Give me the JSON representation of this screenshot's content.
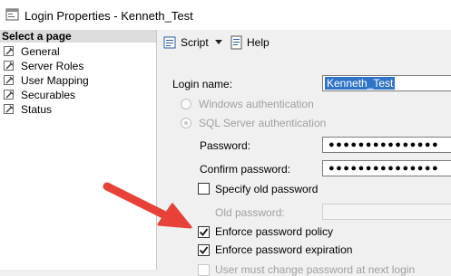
{
  "window": {
    "title": "Login Properties - Kenneth_Test"
  },
  "left_pane": {
    "header": "Select a page",
    "pages": [
      {
        "label": "General"
      },
      {
        "label": "Server Roles"
      },
      {
        "label": "User Mapping"
      },
      {
        "label": "Securables"
      },
      {
        "label": "Status"
      }
    ]
  },
  "toolbar": {
    "script_label": "Script",
    "help_label": "Help"
  },
  "form": {
    "login_name_label": "Login name:",
    "login_name_value": "Kenneth_Test",
    "windows_auth_label": "Windows authentication",
    "sql_auth_label": "SQL Server authentication",
    "password_label": "Password:",
    "password_value": "●●●●●●●●●●●●●●●",
    "confirm_label": "Confirm password:",
    "confirm_value": "●●●●●●●●●●●●●●●",
    "specify_old_label": "Specify old password",
    "old_password_label": "Old password:",
    "enforce_policy_label": "Enforce password policy",
    "enforce_expiration_label": "Enforce password expiration",
    "must_change_label": "User must change password at next login",
    "enforce_policy_checked": true,
    "enforce_expiration_checked": true,
    "specify_old_checked": false
  },
  "colors": {
    "annotation_arrow": "#e8413a",
    "selection": "#3074c8"
  }
}
